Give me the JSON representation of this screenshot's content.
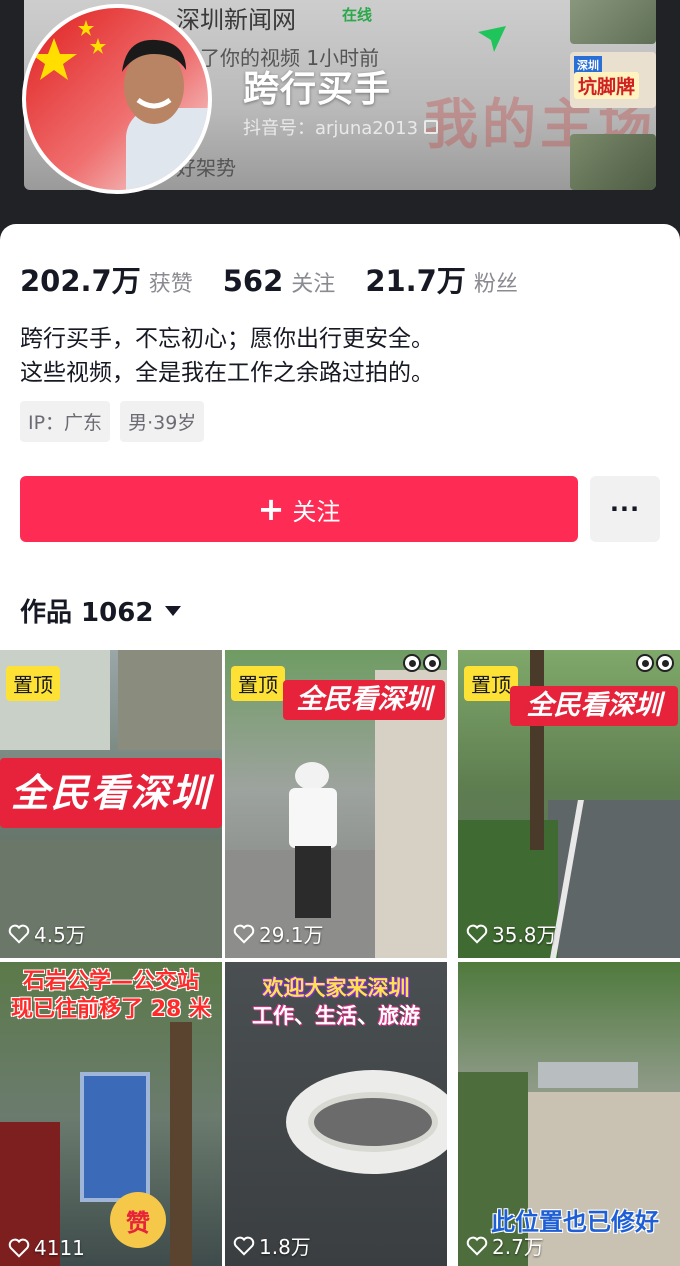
{
  "header": {
    "nickname": "跨行买手",
    "account_label": "抖音号：arjuna2013",
    "banner_news": "深圳新闻网",
    "banner_online": "在线",
    "banner_sub1": "了你的视频 1小时前",
    "banner_sub2": "好架势",
    "banner_bg_text": "我的主场",
    "banner_thumb_lbl1": "深圳",
    "banner_thumb_lbl2": "坑脚牌"
  },
  "stats": [
    {
      "value": "202.7万",
      "label": "获赞"
    },
    {
      "value": "562",
      "label": "关注"
    },
    {
      "value": "21.7万",
      "label": "粉丝"
    }
  ],
  "bio": {
    "line1": "跨行买手，不忘初心；愿你出行更安全。",
    "line2": "这些视频，全是我在工作之余路过拍的。"
  },
  "tags": [
    "IP：广东",
    "男·39岁"
  ],
  "actions": {
    "follow_label": "关注",
    "more_label": "···"
  },
  "works": {
    "title": "作品 1062"
  },
  "videos": [
    {
      "pinned_label": "置顶",
      "overlay": "全民看深圳",
      "likes": "4.5万"
    },
    {
      "pinned_label": "置顶",
      "overlay": "全民看深圳",
      "likes": "29.1万"
    },
    {
      "pinned_label": "置顶",
      "overlay": "全民看深圳",
      "likes": "35.8万"
    },
    {
      "overlay_line1": "石岩公学—公交站",
      "overlay_line2": "现已往前移了 28 米",
      "sticker": "赞",
      "likes": "4111"
    },
    {
      "overlay_line1": "欢迎大家来深圳",
      "overlay_line2": "工作、生活、旅游",
      "likes": "1.8万"
    },
    {
      "overlay": "此位置也已修好",
      "likes": "2.7万"
    }
  ],
  "colors": {
    "accent": "#fe2c55",
    "pin_bg": "#fde235",
    "overlay_red": "#e6233a"
  }
}
